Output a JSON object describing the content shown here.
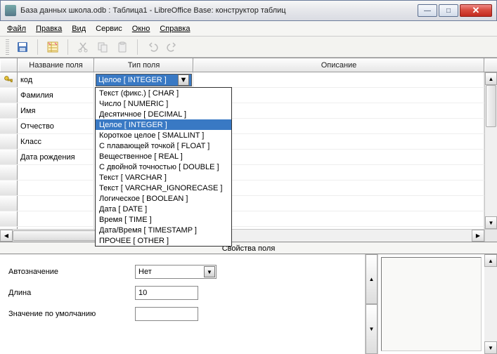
{
  "title": "База данных школа.odb : Таблица1 - LibreOffice Base: конструктор таблиц",
  "menu": {
    "file": "Файл",
    "edit": "Правка",
    "view": "Вид",
    "tools": "Сервис",
    "window": "Окно",
    "help": "Справка"
  },
  "cols": {
    "name": "Название поля",
    "type": "Тип поля",
    "desc": "Описание"
  },
  "rows": [
    {
      "pk": true,
      "name": "код",
      "type": "Целое [ INTEGER ]"
    },
    {
      "pk": false,
      "name": "Фамилия",
      "type": ""
    },
    {
      "pk": false,
      "name": "Имя",
      "type": ""
    },
    {
      "pk": false,
      "name": "Отчество",
      "type": ""
    },
    {
      "pk": false,
      "name": "Класс",
      "type": ""
    },
    {
      "pk": false,
      "name": "Дата рождения",
      "type": ""
    }
  ],
  "type_options": [
    "Текст (фикс.) [ CHAR ]",
    "Число [ NUMERIC ]",
    "Десятичное [ DECIMAL ]",
    "Целое [ INTEGER ]",
    "Короткое целое [ SMALLINT ]",
    "С плавающей точкой [ FLOAT ]",
    "Вещественное [ REAL ]",
    "С двойной точностью [ DOUBLE ]",
    "Текст [ VARCHAR ]",
    "Текст [ VARCHAR_IGNORECASE ]",
    "Логическое [ BOOLEAN ]",
    "Дата [ DATE ]",
    "Время [ TIME ]",
    "Дата/Время [ TIMESTAMP ]",
    "ПРОЧЕЕ [ OTHER ]"
  ],
  "type_selected_index": 3,
  "prop": {
    "header": "Свойства поля",
    "auto_label": "Автозначение",
    "auto_value": "Нет",
    "length_label": "Длина",
    "length_value": "10",
    "default_label": "Значение по умолчанию"
  }
}
